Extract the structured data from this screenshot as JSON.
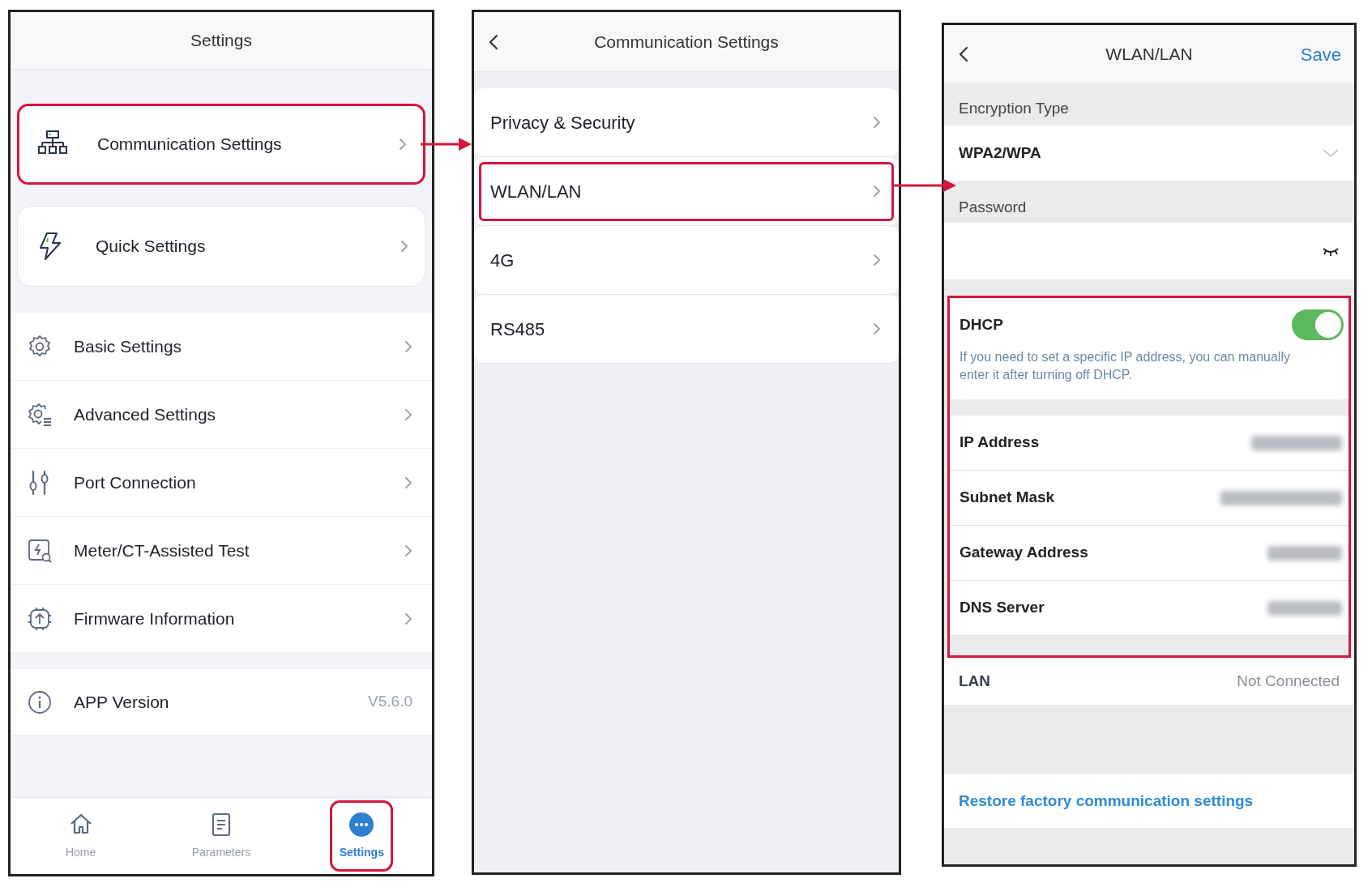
{
  "screens": [
    {
      "kind": "menu",
      "title": "Settings",
      "cards": [
        {
          "label": "Communication Settings",
          "highlighted": true
        },
        {
          "label": "Quick Settings",
          "highlighted": false
        }
      ],
      "items": [
        {
          "label": "Basic Settings"
        },
        {
          "label": "Advanced Settings"
        },
        {
          "label": "Port Connection"
        },
        {
          "label": "Meter/CT-Assisted Test"
        },
        {
          "label": "Firmware Information"
        }
      ],
      "version": {
        "label": "APP Version",
        "value": "V5.6.0"
      },
      "tabs": [
        {
          "label": "Home",
          "selected": false,
          "highlighted": false
        },
        {
          "label": "Parameters",
          "selected": false,
          "highlighted": false
        },
        {
          "label": "Settings",
          "selected": true,
          "highlighted": true
        }
      ]
    },
    {
      "kind": "submenu",
      "title": "Communication Settings",
      "items": [
        {
          "label": "Privacy & Security",
          "highlighted": false
        },
        {
          "label": "WLAN/LAN",
          "highlighted": true
        },
        {
          "label": "4G",
          "highlighted": false
        },
        {
          "label": "RS485",
          "highlighted": false
        }
      ]
    },
    {
      "kind": "form",
      "title": "WLAN/LAN",
      "action": "Save",
      "encryption": {
        "label": "Encryption Type",
        "value": "WPA2/WPA"
      },
      "password": {
        "label": "Password"
      },
      "network": {
        "highlighted": true,
        "dhcp": {
          "label": "DHCP",
          "on": true,
          "note": "If you need to set a specific IP address, you can manually enter it after turning off DHCP."
        },
        "fields": [
          {
            "label": "IP Address",
            "redacted": true
          },
          {
            "label": "Subnet Mask",
            "redacted": true
          },
          {
            "label": "Gateway Address",
            "redacted": true
          },
          {
            "label": "DNS Server",
            "redacted": true
          }
        ]
      },
      "lan": {
        "label": "LAN",
        "value": "Not Connected"
      },
      "restore": "Restore factory communication settings"
    }
  ]
}
